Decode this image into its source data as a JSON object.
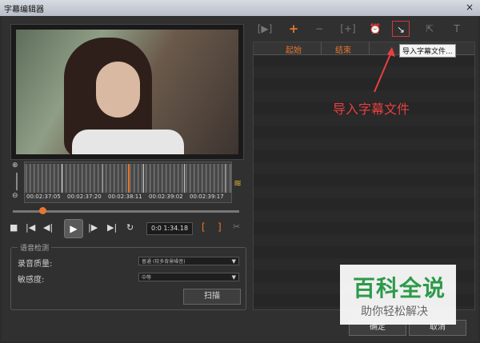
{
  "window": {
    "title": "字幕编辑器",
    "close": "×"
  },
  "timeline": {
    "timecodes": [
      "00:02:37:05",
      "00:02:37:20",
      "00:02:38:11",
      "00:02:39:02",
      "00:02:39:17"
    ]
  },
  "zoom": {
    "in": "⊕",
    "out": "⊖"
  },
  "playback": {
    "stop": "■",
    "prev": "|◀",
    "step_back": "◀|",
    "play": "▶",
    "step_fwd": "|▶",
    "next": "▶|",
    "loop": "↻",
    "timecode": "0:0 1:34.18",
    "mark_in": "[",
    "mark_out": "]",
    "cut": "✂"
  },
  "voice_detection": {
    "legend": "语音检测",
    "quality_label": "录音质量:",
    "quality_value": "普通 (较多背景噪音)",
    "sensitivity_label": "敏感度:",
    "sensitivity_value": "中等",
    "scan_button": "扫描"
  },
  "toolbar": {
    "tooltip": "导入字幕文件..."
  },
  "subtitle_list": {
    "col_start": "起始",
    "col_end": "结束"
  },
  "annotation": "导入字幕文件",
  "buttons": {
    "ok": "确定",
    "cancel": "取消"
  },
  "watermark": {
    "brand": "百科全说",
    "slogan": "助你轻松解决"
  },
  "colors": {
    "accent": "#e8772e",
    "annotation": "#e84040"
  }
}
